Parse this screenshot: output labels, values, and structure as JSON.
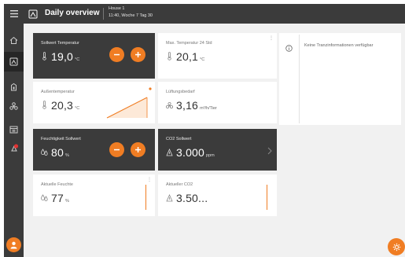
{
  "header": {
    "title": "Daily overview",
    "house": "House 1",
    "time": "11:40, Woche 7 Tag 30"
  },
  "sidebar": {
    "items": [
      {
        "icon": "menu-icon"
      },
      {
        "icon": "home-icon"
      },
      {
        "icon": "dashboard-icon",
        "active": true
      },
      {
        "icon": "silo-icon"
      },
      {
        "icon": "fan-icon"
      },
      {
        "icon": "calendar-icon"
      },
      {
        "icon": "alarm-icon"
      }
    ]
  },
  "cards": {
    "temp_setpoint": {
      "label": "Sollwert Temperatur",
      "value": "19,0",
      "unit": "°C"
    },
    "max_temp": {
      "label": "Max. Temperatur 24 Std",
      "value": "20,1",
      "unit": "°C"
    },
    "outside_temp": {
      "label": "Außentemperatur",
      "value": "20,3",
      "unit": "°C"
    },
    "ventilation": {
      "label": "Lüftungsbedarf",
      "value": "3,16",
      "unit": "m³/h/Tier"
    },
    "humidity_setpoint": {
      "label": "Feuchtigkeit Sollwert",
      "value": "80",
      "unit": "%"
    },
    "co2_setpoint": {
      "label": "CO2 Sollwert",
      "value": "3.000",
      "unit": "ppm"
    },
    "current_humidity": {
      "label": "Aktuelle Feuchte",
      "value": "77",
      "unit": "%"
    },
    "current_co2": {
      "label": "Aktueller CO2",
      "value": "3.50..."
    }
  },
  "info": {
    "message": "Keine Tranzinformationen verfügbar"
  },
  "colors": {
    "accent": "#f07d23",
    "dark": "#3b3b3b",
    "background": "#f1f1f1"
  }
}
